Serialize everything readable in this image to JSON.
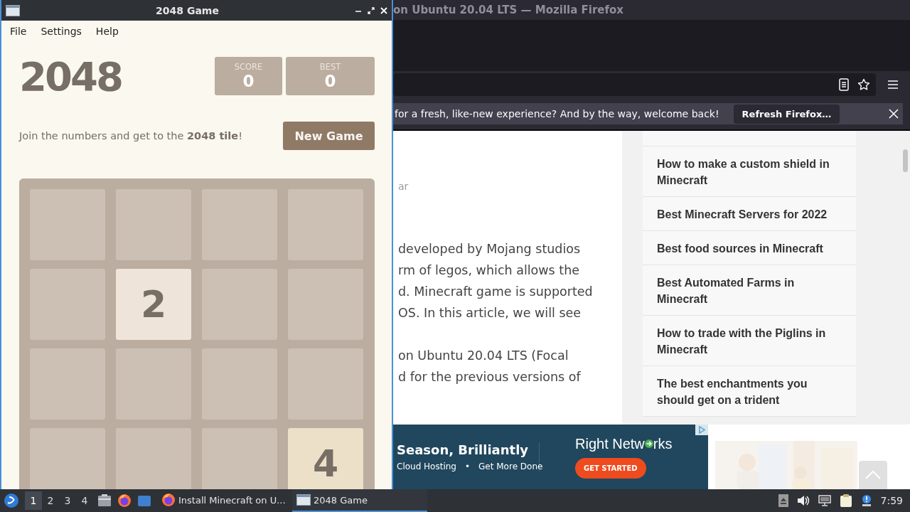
{
  "firefox_window": {
    "title": "on Ubuntu 20.04 LTS — Mozilla Firefox",
    "notification": {
      "message": "for a fresh, like-new experience? And by the way, welcome back!",
      "button": "Refresh Firefox…"
    },
    "article": {
      "byline_fragment": "ar",
      "paragraphs": [
        [
          "developed by Mojang studios",
          "rm of legos, which allows the",
          "d. Minecraft game is supported",
          "OS. In this article, we will see"
        ],
        [
          "on Ubuntu 20.04 LTS (Focal",
          "d for the previous versions of"
        ]
      ]
    },
    "sidebar_links": [
      "How to make a custom shield in Minecraft",
      "Best Minecraft Servers for 2022",
      "Best food sources in Minecraft",
      "Best Automated Farms in Minecraft",
      "How to trade with the Piglins in Minecraft",
      "The best enchantments you should get on a trident"
    ],
    "ad": {
      "headline": "Season, Brilliantly",
      "tagline_items": [
        "Cloud Hosting",
        "Get More Done"
      ],
      "separator": "•",
      "brand": "Right Netw",
      "brand_end": "rks",
      "button": "GET STARTED"
    }
  },
  "game_window": {
    "title": "2048 Game",
    "menu": [
      "File",
      "Settings",
      "Help"
    ],
    "heading": "2048",
    "scores": [
      {
        "label": "SCORE",
        "value": "0"
      },
      {
        "label": "BEST",
        "value": "0"
      }
    ],
    "intro": "Join the numbers and get to the **2048 tile**!",
    "new_game_button": "New Game",
    "board": [
      [
        {
          "kind": "empty"
        },
        {
          "kind": "empty"
        },
        {
          "kind": "empty"
        },
        {
          "kind": "empty"
        }
      ],
      [
        {
          "kind": "empty"
        },
        {
          "kind": "tile",
          "value": "2",
          "color": "#eee4da"
        },
        {
          "kind": "empty"
        },
        {
          "kind": "empty"
        }
      ],
      [
        {
          "kind": "empty"
        },
        {
          "kind": "empty"
        },
        {
          "kind": "empty"
        },
        {
          "kind": "empty"
        }
      ],
      [
        {
          "kind": "empty"
        },
        {
          "kind": "empty"
        },
        {
          "kind": "empty"
        },
        {
          "kind": "tile",
          "value": "4",
          "color": "#ede0c8"
        }
      ]
    ]
  },
  "taskbar": {
    "workspaces": [
      {
        "label": "1",
        "selected": true
      },
      {
        "label": "2",
        "selected": false
      },
      {
        "label": "3",
        "selected": false
      },
      {
        "label": "4",
        "selected": false
      }
    ],
    "tasks": [
      {
        "label": "Install Minecraft on U...",
        "kind": "browser",
        "selected": false
      },
      {
        "label": "2048 Game",
        "kind": "window",
        "selected": true
      }
    ],
    "clock": "7:59"
  }
}
